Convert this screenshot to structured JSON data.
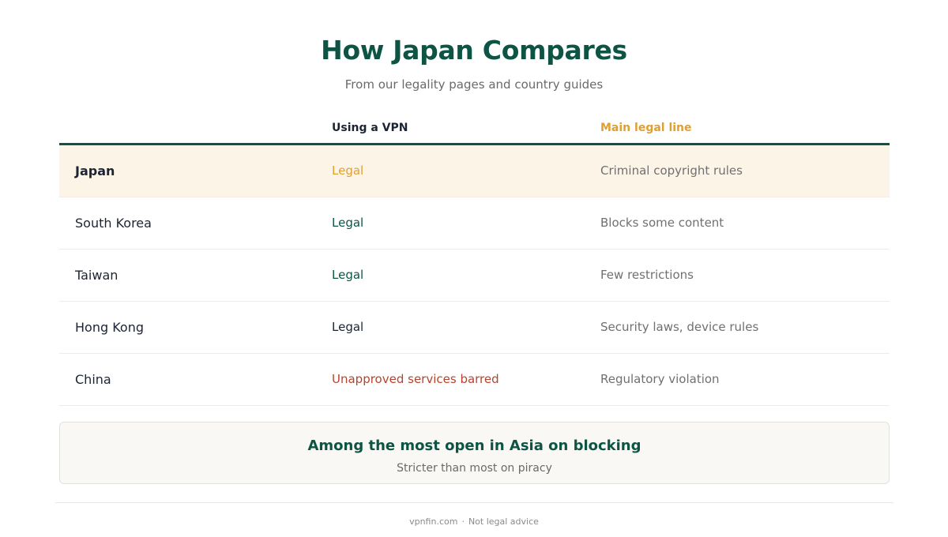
{
  "header": {
    "title": "How Japan Compares",
    "subtitle": "From our legality pages and country guides"
  },
  "table": {
    "columns": [
      "",
      "Using a VPN",
      "Main legal line"
    ],
    "column_colors": {
      "vpn": "#1c2434",
      "legal_line": "#e0a030"
    },
    "rows": [
      {
        "country": "Japan",
        "vpn": "Legal",
        "legal_line": "Criminal copyright rules",
        "highlight": true,
        "status_color": "#e0a030"
      },
      {
        "country": "South Korea",
        "vpn": "Legal",
        "legal_line": "Blocks some content",
        "highlight": false,
        "status_color": "#0d5444"
      },
      {
        "country": "Taiwan",
        "vpn": "Legal",
        "legal_line": "Few restrictions",
        "highlight": false,
        "status_color": "#0d5444"
      },
      {
        "country": "Hong Kong",
        "vpn": "Legal",
        "legal_line": "Security laws, device rules",
        "highlight": false,
        "status_color": "#1c2434"
      },
      {
        "country": "China",
        "vpn": "Unapproved services barred",
        "legal_line": "Regulatory violation",
        "highlight": false,
        "status_color": "#b5442e"
      }
    ]
  },
  "summary": {
    "headline": "Among the most open in Asia on blocking",
    "subline": "Stricter than most on piracy"
  },
  "footer": {
    "site": "vpnfin.com",
    "separator": "·",
    "disclaimer": "Not legal advice"
  },
  "colors": {
    "brand_green": "#0d5444",
    "accent_amber": "#e0a030",
    "warning_red": "#b5442e",
    "highlight_bg": "#fdf4e8"
  }
}
